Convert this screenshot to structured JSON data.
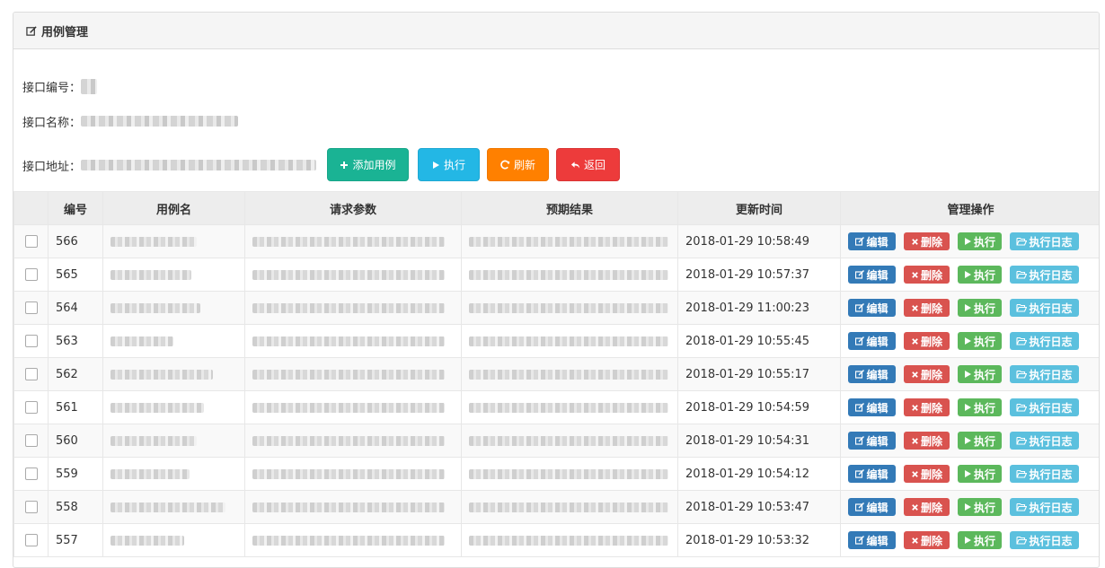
{
  "panel": {
    "title": "用例管理"
  },
  "fields": {
    "interface_id_label": "接口编号：",
    "interface_name_label": "接口名称：",
    "interface_url_label": "接口地址："
  },
  "toolbar": {
    "add_label": "添加用例",
    "run_label": "执行",
    "refresh_label": "刷新",
    "back_label": "返回"
  },
  "table": {
    "headers": [
      "编号",
      "用例名",
      "请求参数",
      "预期结果",
      "更新时间",
      "管理操作"
    ],
    "rows": [
      {
        "id": "566",
        "time": "2018-01-29 10:58:49"
      },
      {
        "id": "565",
        "time": "2018-01-29 10:57:37"
      },
      {
        "id": "564",
        "time": "2018-01-29 11:00:23"
      },
      {
        "id": "563",
        "time": "2018-01-29 10:55:45"
      },
      {
        "id": "562",
        "time": "2018-01-29 10:55:17"
      },
      {
        "id": "561",
        "time": "2018-01-29 10:54:59"
      },
      {
        "id": "560",
        "time": "2018-01-29 10:54:31"
      },
      {
        "id": "559",
        "time": "2018-01-29 10:54:12"
      },
      {
        "id": "558",
        "time": "2018-01-29 10:53:47"
      },
      {
        "id": "557",
        "time": "2018-01-29 10:53:32"
      }
    ],
    "actions": {
      "edit": "编辑",
      "delete": "删除",
      "run": "执行",
      "log": "执行日志"
    }
  },
  "colors": {
    "add": "#1ab394",
    "run": "#23b7e5",
    "refresh": "#ff8000",
    "back": "#ed3b3b",
    "op_edit": "#337ab7",
    "op_delete": "#d9534f",
    "op_run": "#5cb85c",
    "op_log": "#5bc0de"
  },
  "icons": {
    "title": "edit-icon",
    "add": "plus-icon",
    "run": "play-icon",
    "refresh": "refresh-icon",
    "back": "reply-icon",
    "op_edit": "edit-icon",
    "op_delete": "close-icon",
    "op_run": "play-icon",
    "op_log": "folder-open-icon"
  }
}
